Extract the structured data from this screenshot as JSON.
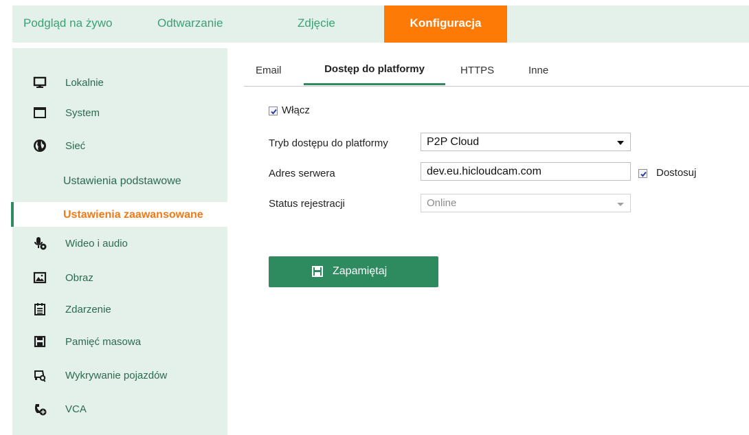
{
  "topnav": {
    "tabs": [
      {
        "label": "Podgląd na żywo"
      },
      {
        "label": "Odtwarzanie"
      },
      {
        "label": "Zdjęcie"
      },
      {
        "label": "Konfiguracja"
      }
    ],
    "active_color": "#fc7a05"
  },
  "sidebar": {
    "items": [
      {
        "label": "Lokalnie",
        "icon": "monitor-icon"
      },
      {
        "label": "System",
        "icon": "window-icon"
      },
      {
        "label": "Sieć",
        "icon": "globe-icon"
      },
      {
        "label": "Ustawienia podstawowe"
      },
      {
        "label": "Ustawienia zaawansowane"
      },
      {
        "label": "Wideo i audio",
        "icon": "microphone-icon"
      },
      {
        "label": "Obraz",
        "icon": "image-icon"
      },
      {
        "label": "Zdarzenie",
        "icon": "calendar-icon"
      },
      {
        "label": "Pamięć masowa",
        "icon": "floppy-icon"
      },
      {
        "label": "Wykrywanie pojazdów",
        "icon": "vehicle-search-icon"
      },
      {
        "label": "VCA",
        "icon": "vca-icon"
      }
    ],
    "accent_color": "#f07a18"
  },
  "subtabs": [
    {
      "label": "Email"
    },
    {
      "label": "Dostęp do platformy"
    },
    {
      "label": "HTTPS"
    },
    {
      "label": "Inne"
    }
  ],
  "form": {
    "enable_label": "Włącz",
    "enable_checked": true,
    "mode_label": "Tryb dostępu do platformy",
    "mode_value": "P2P Cloud",
    "server_label": "Adres serwera",
    "server_value": "dev.eu.hicloudcam.com",
    "custom_label": "Dostosuj",
    "custom_checked": true,
    "status_label": "Status rejestracji",
    "status_value": "Online"
  },
  "save_button": {
    "label": "Zapamiętaj",
    "icon": "floppy-icon",
    "color": "#2e8b60"
  }
}
